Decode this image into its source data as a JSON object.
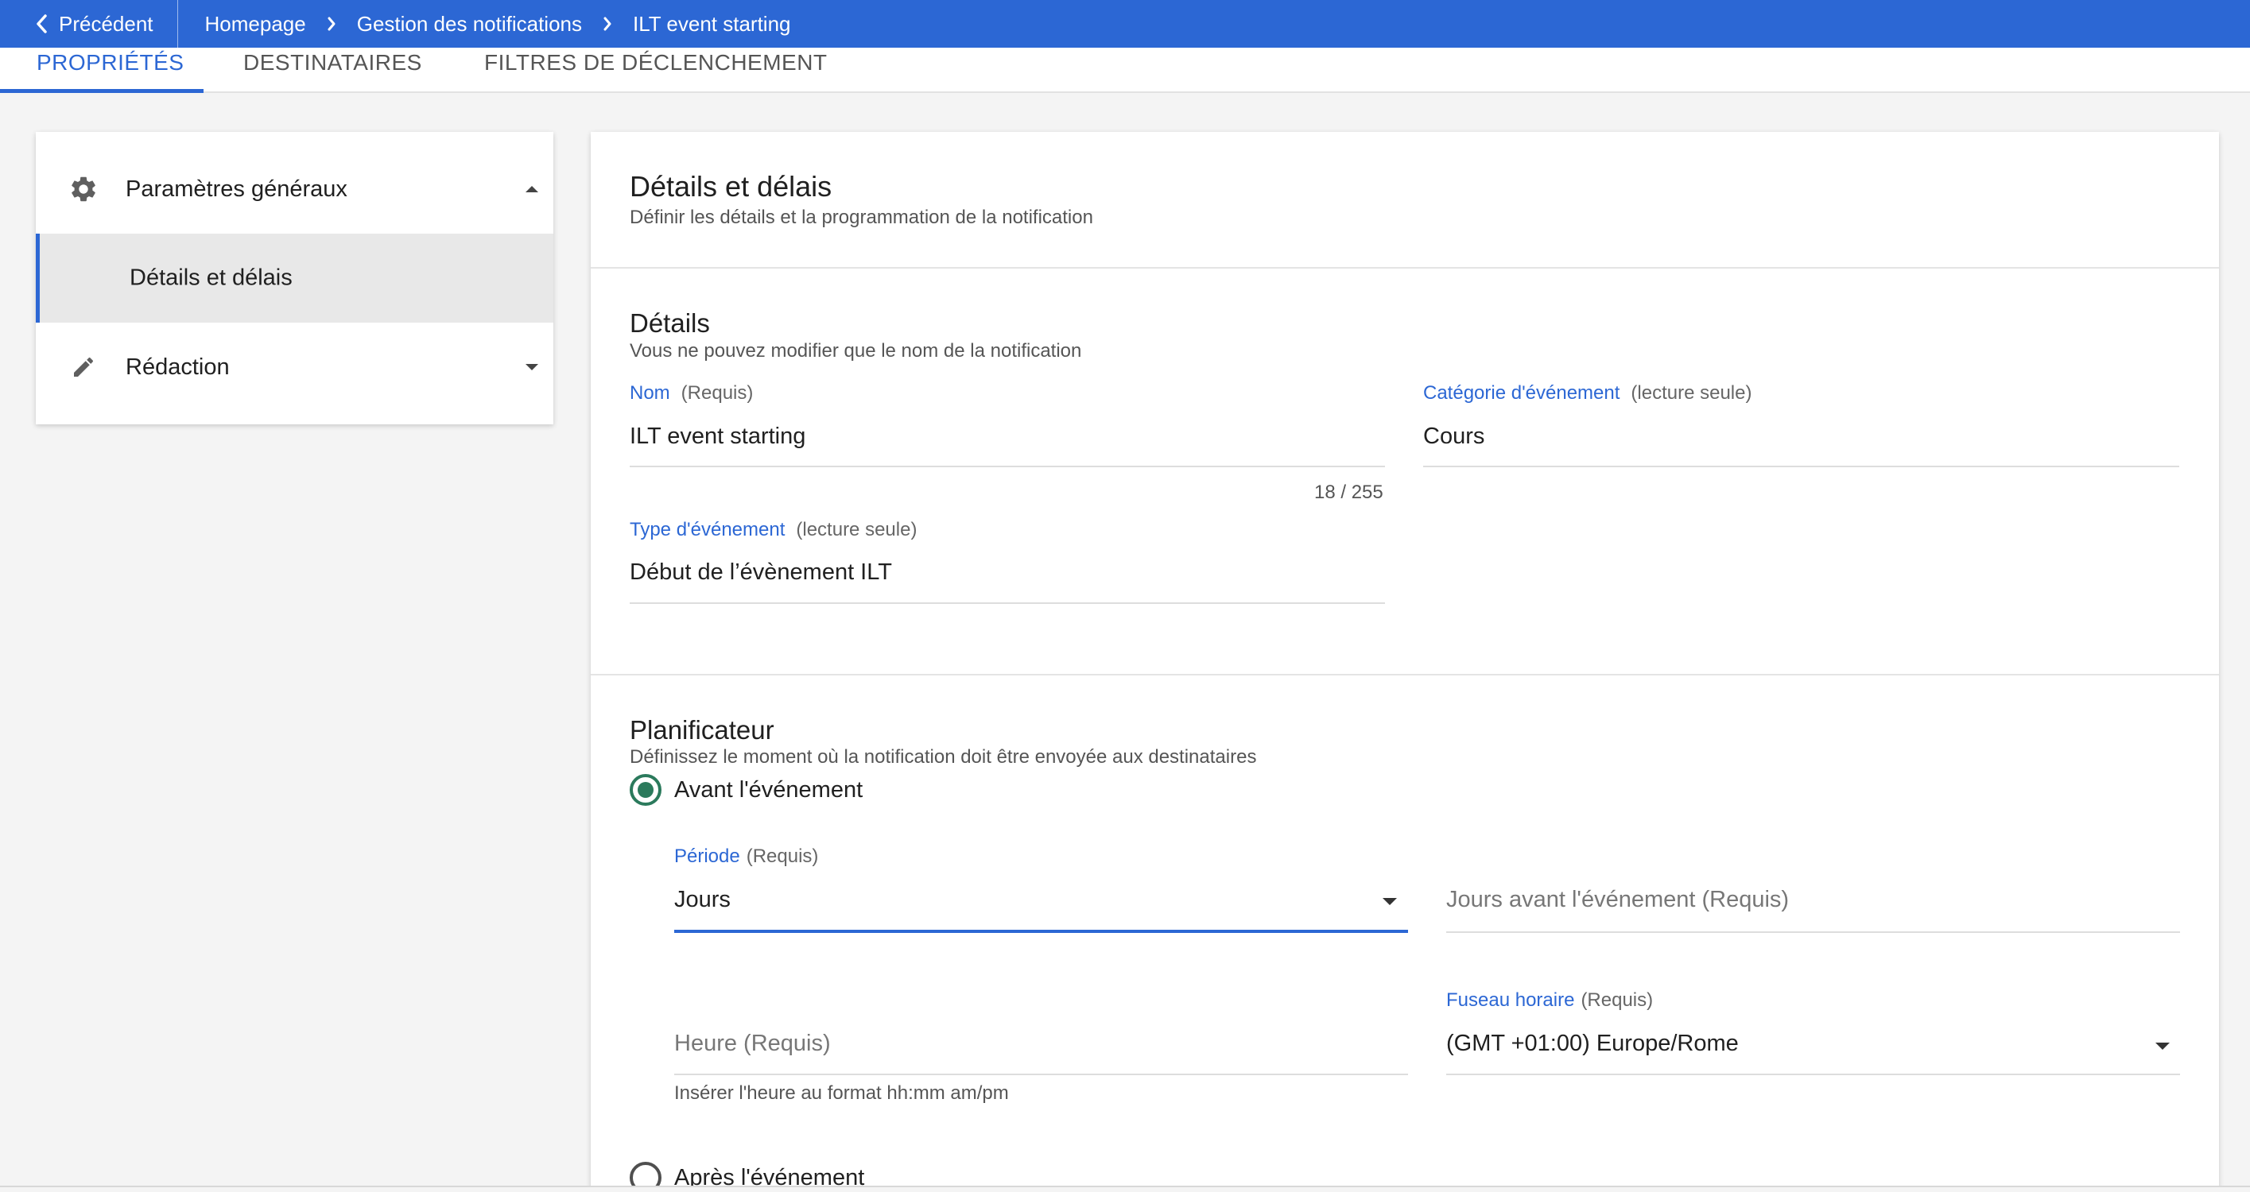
{
  "topbar": {
    "back_label": "Précédent",
    "breadcrumbs": [
      "Homepage",
      "Gestion des notifications",
      "ILT event starting"
    ],
    "bg_color": "#2c67d4"
  },
  "tabs": [
    {
      "label": "PROPRIÉTÉS",
      "active": true
    },
    {
      "label": "DESTINATAIRES",
      "active": false
    },
    {
      "label": "FILTRES DE DÉCLENCHEMENT",
      "active": false
    }
  ],
  "sidebar": {
    "sections": [
      {
        "label": "Paramètres généraux",
        "icon": "gear-icon",
        "expanded": true,
        "items": [
          {
            "label": "Détails et délais",
            "selected": true
          }
        ]
      },
      {
        "label": "Rédaction",
        "icon": "pencil-icon",
        "expanded": false
      }
    ]
  },
  "main": {
    "title": "Détails et délais",
    "subtitle": "Définir les détails et la programmation de la notification",
    "details": {
      "title": "Détails",
      "subtitle": "Vous ne pouvez modifier que le nom de la notification",
      "name_label": "Nom",
      "name_qualifier": "(Requis)",
      "name_value": "ILT event starting",
      "name_counter": "18 / 255",
      "category_label": "Catégorie d'événement",
      "category_qualifier": "(lecture seule)",
      "category_value": "Cours",
      "type_label": "Type d'événement",
      "type_qualifier": "(lecture seule)",
      "type_value": "Début de l’évènement ILT"
    },
    "scheduler": {
      "title": "Planificateur",
      "subtitle": "Définissez le moment où la notification doit être envoyée aux destinataires",
      "before_label": "Avant l'événement",
      "before_checked": true,
      "period_label": "Période",
      "period_qualifier": "(Requis)",
      "period_value": "Jours",
      "days_before_placeholder": "Jours avant l'événement  (Requis)",
      "time_placeholder": "Heure  (Requis)",
      "time_hint": "Insérer l'heure au format hh:mm am/pm",
      "timezone_label": "Fuseau horaire",
      "timezone_qualifier": "(Requis)",
      "timezone_value": "(GMT +01:00) Europe/Rome",
      "after_label": "Après l'événement",
      "after_checked": false
    }
  }
}
